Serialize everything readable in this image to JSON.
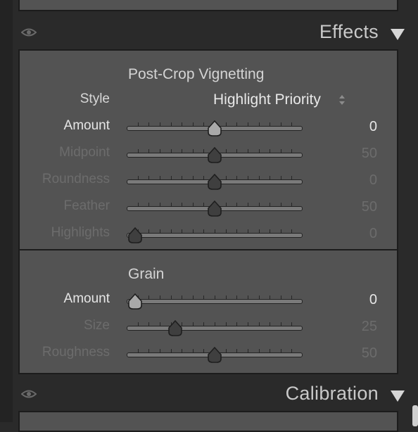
{
  "effects_header": {
    "title": "Effects"
  },
  "vignetting": {
    "title": "Post-Crop Vignetting",
    "style": {
      "label": "Style",
      "value": "Highlight Priority"
    },
    "sliders": [
      {
        "label": "Amount",
        "value": "0",
        "level": 0.5,
        "enabled": true,
        "thumb": "light"
      },
      {
        "label": "Midpoint",
        "value": "50",
        "level": 0.5,
        "enabled": false,
        "thumb": "dark"
      },
      {
        "label": "Roundness",
        "value": "0",
        "level": 0.5,
        "enabled": false,
        "thumb": "dark"
      },
      {
        "label": "Feather",
        "value": "50",
        "level": 0.5,
        "enabled": false,
        "thumb": "dark"
      },
      {
        "label": "Highlights",
        "value": "0",
        "level": 0.0,
        "enabled": false,
        "thumb": "dark"
      }
    ]
  },
  "grain": {
    "title": "Grain",
    "sliders": [
      {
        "label": "Amount",
        "value": "0",
        "level": 0.0,
        "enabled": true,
        "thumb": "light"
      },
      {
        "label": "Size",
        "value": "25",
        "level": 0.25,
        "enabled": false,
        "thumb": "dark"
      },
      {
        "label": "Roughness",
        "value": "50",
        "level": 0.5,
        "enabled": false,
        "thumb": "dark"
      }
    ]
  },
  "calibration_header": {
    "title": "Calibration"
  },
  "icons": {
    "visibility": "eye-icon",
    "collapse": "triangle-down-icon",
    "stepper": "up-down-arrows-icon"
  },
  "colors": {
    "panel": "#535353",
    "background": "#2a2a2a",
    "text_enabled": "#e6e6e6",
    "text_disabled": "#6c6c6c"
  }
}
